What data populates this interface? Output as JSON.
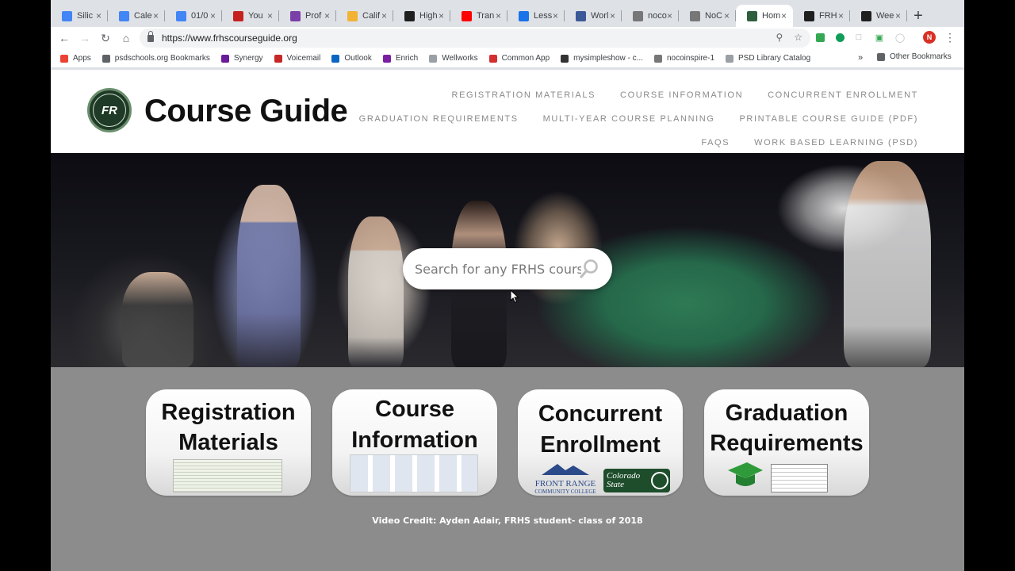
{
  "browser": {
    "tabs": [
      {
        "title": "Silic",
        "icon": "google-docs-icon",
        "color": "#4285f4"
      },
      {
        "title": "Cale",
        "icon": "google-docs-icon",
        "color": "#4285f4"
      },
      {
        "title": "01/0",
        "icon": "google-docs-icon",
        "color": "#4285f4"
      },
      {
        "title": "You",
        "icon": "red-grid-icon",
        "color": "#c5221f"
      },
      {
        "title": "Prof",
        "icon": "purple-form-icon",
        "color": "#7b3fa8"
      },
      {
        "title": "Calif",
        "icon": "sun-icon",
        "color": "#f2b233"
      },
      {
        "title": "High",
        "icon": "w-icon",
        "color": "#1f1f1f"
      },
      {
        "title": "Tran",
        "icon": "youtube-icon",
        "color": "#ff0000"
      },
      {
        "title": "Less",
        "icon": "w-blue-icon",
        "color": "#1a73e8"
      },
      {
        "title": "Worl",
        "icon": "cursor-icon",
        "color": "#3b5998"
      },
      {
        "title": "noco",
        "icon": "noco-icon",
        "color": "#777777"
      },
      {
        "title": "NoC",
        "icon": "noco-icon",
        "color": "#777777"
      },
      {
        "title": "Hom",
        "icon": "frhs-icon",
        "color": "#2e5e3e",
        "active": true
      },
      {
        "title": "FRH",
        "icon": "w-icon",
        "color": "#1f1f1f"
      },
      {
        "title": "Wee",
        "icon": "w-icon",
        "color": "#1f1f1f"
      }
    ],
    "url": "https://www.frhscourseguide.org",
    "bookmarks": [
      {
        "label": "Apps",
        "icon": "apps-grid-icon"
      },
      {
        "label": "psdschools.org Bookmarks",
        "icon": "folder-icon"
      },
      {
        "label": "Synergy",
        "icon": "synergy-icon"
      },
      {
        "label": "Voicemail",
        "icon": "voicemail-icon"
      },
      {
        "label": "Outlook",
        "icon": "outlook-icon"
      },
      {
        "label": "Enrich",
        "icon": "enrich-icon"
      },
      {
        "label": "Wellworks",
        "icon": "page-icon"
      },
      {
        "label": "Common App",
        "icon": "commonapp-icon"
      },
      {
        "label": "mysimpleshow - c...",
        "icon": "simpleshow-icon"
      },
      {
        "label": "nocoinspire-1",
        "icon": "noco-icon"
      },
      {
        "label": "PSD Library Catalog",
        "icon": "page-icon"
      }
    ],
    "bookmarks_more": "»",
    "other_bookmarks": "Other Bookmarks",
    "profile_initial": "N"
  },
  "site": {
    "title": "Course Guide",
    "logo_text": "FR",
    "nav_rows": [
      [
        "Registration Materials",
        "Course Information",
        "Concurrent Enrollment"
      ],
      [
        "Graduation Requirements",
        "Multi-Year Course Planning",
        "Printable Course Guide (PDF)"
      ],
      [
        "FAQs",
        "Work Based Learning (PSD)"
      ]
    ],
    "search_placeholder": "Search for any FRHS course",
    "tiles": [
      {
        "line1": "Registration",
        "line2": "Materials"
      },
      {
        "line1": "Course",
        "line2": "Information"
      },
      {
        "line1": "Concurrent",
        "line2": "Enrollment",
        "logo_left": "FRONT RANGE",
        "logo_left_sub": "COMMUNITY COLLEGE",
        "logo_right": "Colorado State"
      },
      {
        "line1": "Graduation",
        "line2": "Requirements"
      }
    ],
    "credit": "Video Credit: Ayden Adair, FRHS student- class of 2018"
  },
  "colors": {
    "accent_green": "#2e6b47",
    "tiles_bg": "#8c8c8c",
    "nav_text": "#8a8a8a"
  }
}
